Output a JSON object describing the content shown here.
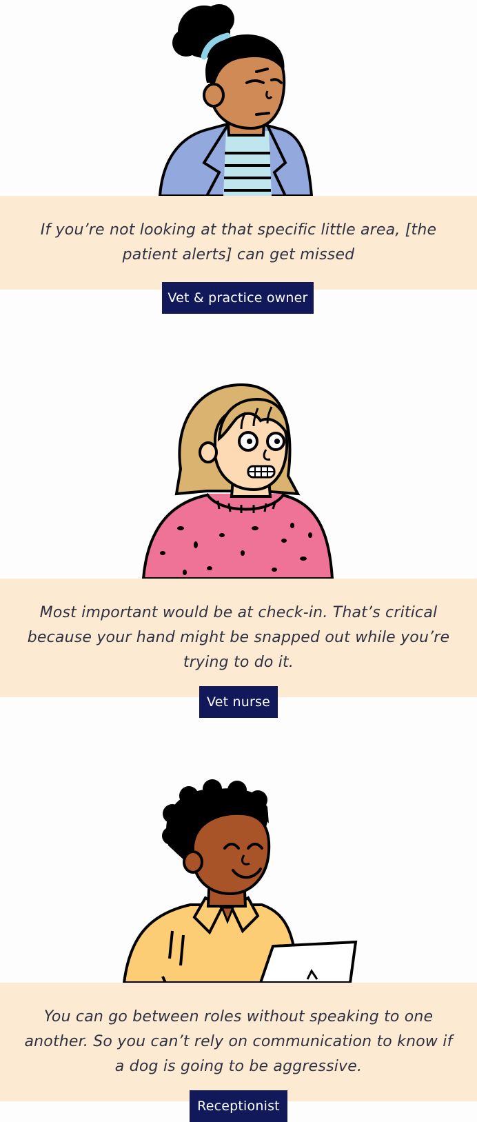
{
  "testimonials": [
    {
      "quote": "If you’re not looking at that specific little area, [the patient alerts] can get missed",
      "role": "Vet & practice owner",
      "illustration": "person-curly-bun-blue-blazer"
    },
    {
      "quote": "Most important would be at check-in. That’s critical because your hand might be snapped out while you’re trying to do it.",
      "role": "Vet nurse",
      "illustration": "person-blonde-bob-pink-sweater"
    },
    {
      "quote": "You can go between roles without speaking to one another. So you can’t rely on communication to know if a dog is going to be aggressive.",
      "role": "Receptionist",
      "illustration": "person-short-curly-yellow-shirt"
    }
  ],
  "colors": {
    "band": "#fdead3",
    "badge": "#11195a",
    "text": "#2f3140"
  }
}
